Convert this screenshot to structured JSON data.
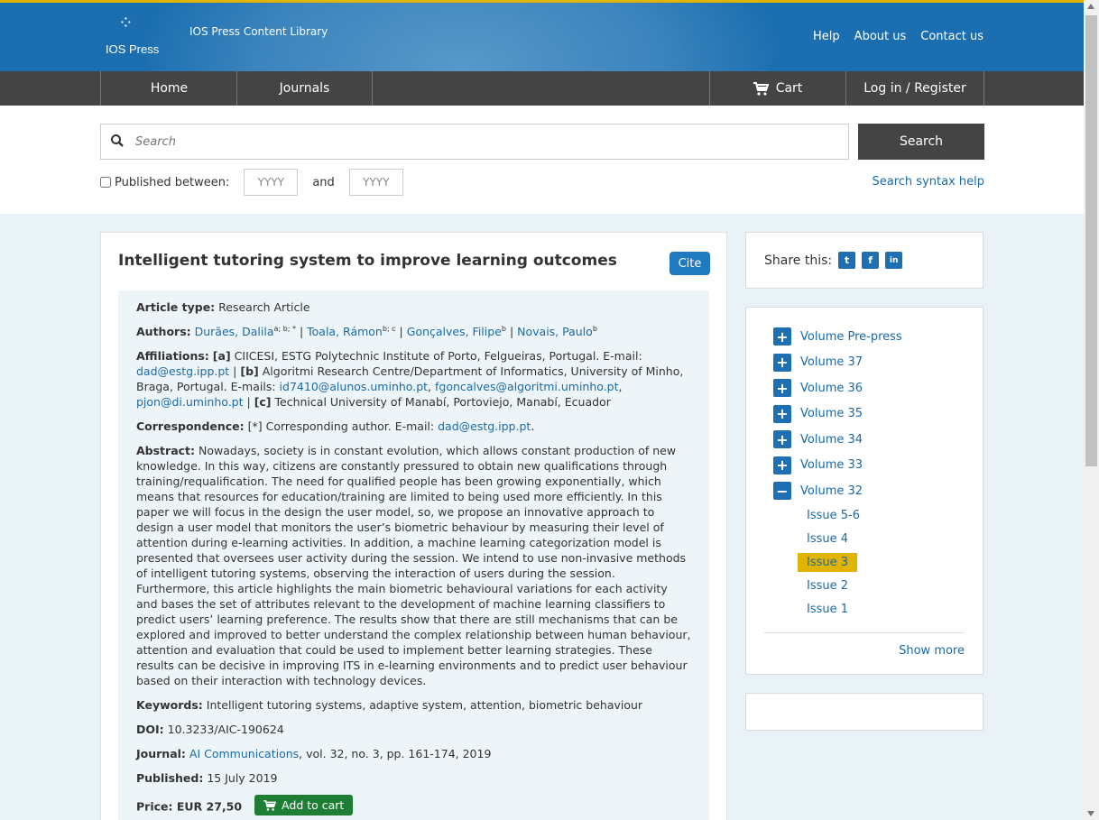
{
  "header": {
    "logo_text": "IOS Press",
    "library_title": "IOS Press Content Library",
    "links": [
      "Help",
      "About us",
      "Contact us"
    ]
  },
  "nav": {
    "home": "Home",
    "journals": "Journals",
    "cart": "Cart",
    "login": "Log in / Register"
  },
  "search": {
    "placeholder": "Search",
    "button": "Search",
    "published_between": "Published between:",
    "year_from_placeholder": "YYYY",
    "and": "and",
    "year_to_placeholder": "YYYY",
    "syntax_help": "Search syntax help"
  },
  "article": {
    "title": "Intelligent tutoring system to improve learning outcomes",
    "cite": "Cite",
    "type_label": "Article type:",
    "type": "Research Article",
    "authors_label": "Authors:",
    "authors": [
      {
        "name": "Durães, Dalila",
        "sup": "a; b; *"
      },
      {
        "name": "Toala, Rámon",
        "sup": "b; c"
      },
      {
        "name": "Gonçalves, Filipe",
        "sup": "b"
      },
      {
        "name": "Novais, Paulo",
        "sup": "b"
      }
    ],
    "affiliations_label": "Affiliations:",
    "aff_a_tag": "[a]",
    "aff_a": "CIICESI, ESTG Polytechnic Institute of Porto, Felgueiras, Portugal. E-mail:",
    "aff_a_email": "dad@estg.ipp.pt",
    "aff_b_tag": "[b]",
    "aff_b": "Algoritmi Research Centre/Department of Informatics, University of Minho, Braga, Portugal. E-mails:",
    "aff_b_emails": [
      "id7410@alunos.uminho.pt",
      "fgoncalves@algoritmi.uminho.pt",
      "pjon@di.uminho.pt"
    ],
    "aff_c_tag": "[c]",
    "aff_c": "Technical University of Manabí, Portoviejo, Manabí, Ecuador",
    "correspondence_label": "Correspondence:",
    "correspondence": "[*] Corresponding author. E-mail:",
    "correspondence_email": "dad@estg.ipp.pt",
    "abstract_label": "Abstract:",
    "abstract": "Nowadays, society is in constant evolution, which allows constant production of new knowledge. In this way, citizens are constantly pressured to obtain new qualifications through training/requalification. The need for qualified people has been growing exponentially, which means that resources for education/training are limited to being used more efficiently. In this paper we will focus in the design the user model, so, we propose an innovative approach to design a user model that monitors the user’s biometric behaviour by measuring their level of attention during e-learning activities. In addition, a machine learning categorization model is presented that oversees user activity during the session. We intend to use non-invasive methods of intelligent tutoring systems, observing the interaction of users during the session. Furthermore, this article highlights the main biometric behavioural variations for each activity and bases the set of attributes relevant to the development of machine learning classifiers to predict users’ learning preference. The results show that there are still mechanisms that can be explored and improved to better understand the complex relationship between human behaviour, attention and evaluation that could be used to implement better learning strategies. These results can be decisive in improving ITS in e-learning environments and to predict user behaviour based on their interaction with technology devices.",
    "keywords_label": "Keywords:",
    "keywords": "Intelligent tutoring systems, adaptive system, attention, biometric behaviour",
    "doi_label": "DOI:",
    "doi": "10.3233/AIC-190624",
    "journal_label": "Journal:",
    "journal_name": "AI Communications",
    "journal_details": ", vol. 32, no. 3, pp. 161-174, 2019",
    "published_label": "Published:",
    "published": "15 July 2019",
    "price_label": "Price: EUR 27,50",
    "add_to_cart": "Add to cart"
  },
  "share": {
    "label": "Share this:",
    "twitter": "t",
    "facebook": "f",
    "linkedin": "in"
  },
  "volumes": {
    "items": [
      "Volume Pre-press",
      "Volume 37",
      "Volume 36",
      "Volume 35",
      "Volume 34",
      "Volume 33",
      "Volume 32"
    ],
    "issues": [
      "Issue 5-6",
      "Issue 4",
      "Issue 3",
      "Issue 2",
      "Issue 1"
    ],
    "active_issue": "Issue 3",
    "show_more": "Show more"
  },
  "colors": {
    "header_blue": "#1b6fb0",
    "accent_yellow": "#e0b400",
    "nav_dark": "#444444",
    "link_blue": "#1a6aa8",
    "cart_green": "#1e7e34"
  }
}
